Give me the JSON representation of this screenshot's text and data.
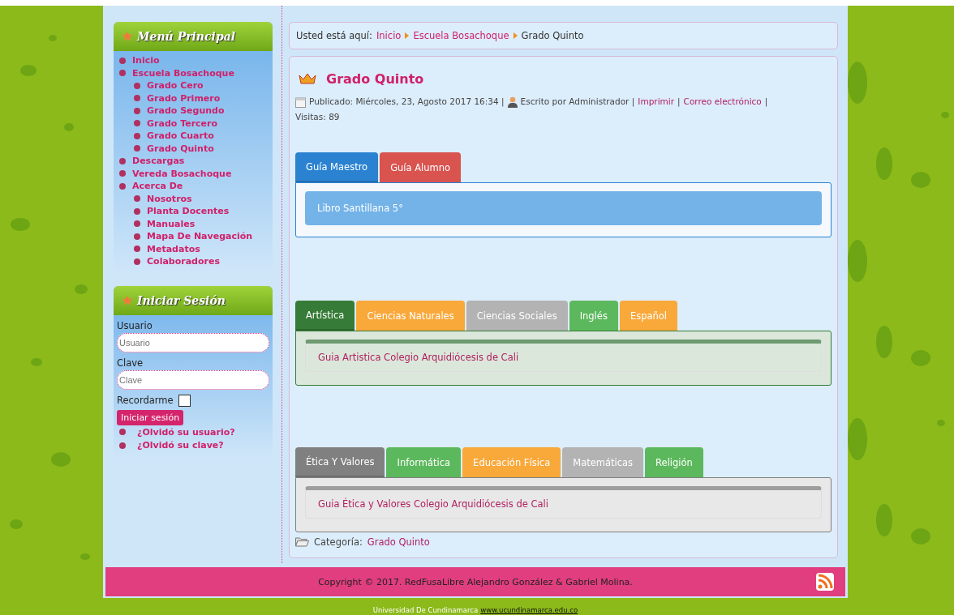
{
  "menu": {
    "title": "Menú Principal",
    "items": [
      {
        "label": "Inicio"
      },
      {
        "label": "Escuela Bosachoque",
        "children": [
          {
            "label": "Grado Cero"
          },
          {
            "label": "Grado Primero"
          },
          {
            "label": "Grado Segundo"
          },
          {
            "label": "Grado Tercero"
          },
          {
            "label": "Grado Cuarto"
          },
          {
            "label": "Grado Quinto"
          }
        ]
      },
      {
        "label": "Descargas"
      },
      {
        "label": "Vereda Bosachoque"
      },
      {
        "label": "Acerca De",
        "children": [
          {
            "label": "Nosotros"
          },
          {
            "label": "Planta Docentes"
          },
          {
            "label": "Manuales"
          },
          {
            "label": "Mapa De Navegación"
          },
          {
            "label": "Metadatos"
          },
          {
            "label": "Colaboradores"
          }
        ]
      }
    ]
  },
  "login": {
    "title": "Iniciar Sesión",
    "user_label": "Usuario",
    "user_placeholder": "Usuario",
    "pass_label": "Clave",
    "pass_placeholder": "Clave",
    "remember_label": "Recordarme",
    "remember_checked": false,
    "submit": "Iniciar sesión",
    "links": [
      "¿Olvidó su usuario?",
      "¿Olvidó su clave?"
    ]
  },
  "breadcrumb": {
    "prefix": "Usted está aquí:",
    "links": [
      "Inicio",
      "Escuela Bosachoque"
    ],
    "current": "Grado Quinto"
  },
  "article": {
    "title": "Grado Quinto",
    "published": "Publicado: Miércoles, 23, Agosto 2017 16:34 |",
    "author": "Escrito por Administrador |",
    "print": "Imprimir",
    "separator": "|",
    "email": "Correo electrónico",
    "visits": "Visitas: 89",
    "tab_groups": [
      {
        "tabs": [
          {
            "label": "Guía Maestro",
            "color": "#2a82d0",
            "selected": true
          },
          {
            "label": "Guía Alumno",
            "color": "#d9534f",
            "selected": false
          }
        ],
        "item": {
          "kind": "block",
          "text": "Libro Santillana 5°"
        }
      },
      {
        "tabs": [
          {
            "label": "Artística",
            "color": "#367b37",
            "selected": true
          },
          {
            "label": "Ciencias Naturales",
            "color": "#f9a83a",
            "selected": false
          },
          {
            "label": "Ciencias Sociales",
            "color": "#b3b3b3",
            "selected": false
          },
          {
            "label": "Inglés",
            "color": "#5cb85c",
            "selected": false
          },
          {
            "label": "Español",
            "color": "#f9a83a",
            "selected": false
          }
        ],
        "item": {
          "kind": "link",
          "text": "Guia Artistica Colegio Arquidiócesis de Cali"
        }
      },
      {
        "tabs": [
          {
            "label": "Ética Y Valores",
            "color": "#808080",
            "selected": true
          },
          {
            "label": "Informática",
            "color": "#5cb85c",
            "selected": false
          },
          {
            "label": "Educación Física",
            "color": "#f9a83a",
            "selected": false
          },
          {
            "label": "Matemáticas",
            "color": "#b3b3b3",
            "selected": false
          },
          {
            "label": "Religión",
            "color": "#5cb85c",
            "selected": false
          }
        ],
        "item": {
          "kind": "link",
          "text": "Guia Ética y Valores Colegio Arquidiócesis de Cali"
        }
      }
    ],
    "category_label": "Categoría:",
    "category": "Grado Quinto"
  },
  "footer": {
    "copyright": "Copyright © 2017. RedFusaLibre Alejandro González & Gabriel Molina.",
    "university": "Universidad De Cundinamarca",
    "url": "www.ucundinamarca.edu.co"
  }
}
